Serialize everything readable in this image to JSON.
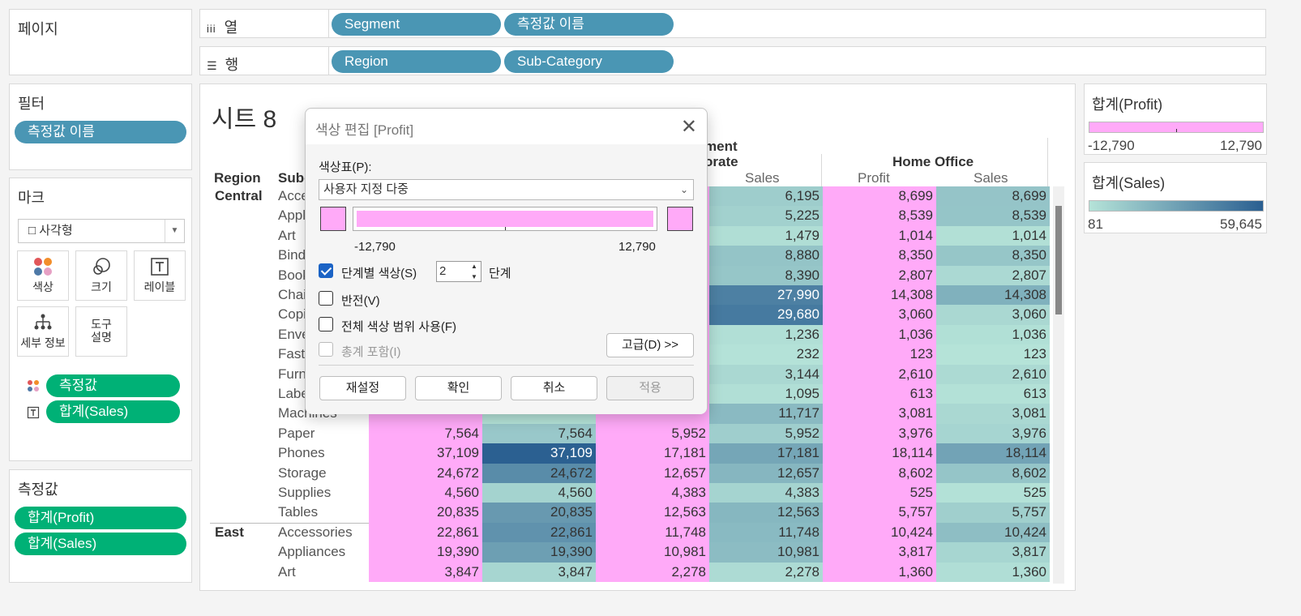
{
  "pages_panel": {
    "title": "페이지"
  },
  "filters_panel": {
    "title": "필터",
    "items": [
      "측정값 이름"
    ]
  },
  "marks_panel": {
    "title": "마크",
    "mark_type": "□ 사각형",
    "buttons": {
      "color": "색상",
      "size": "크기",
      "label": "레이블",
      "detail": "세부 정보",
      "tooltip_1": "도구",
      "tooltip_2": "설명"
    },
    "fields": [
      "측정값",
      "합계(Sales)"
    ]
  },
  "measure_values_panel": {
    "title": "측정값",
    "items": [
      "합계(Profit)",
      "합계(Sales)"
    ]
  },
  "columns_shelf": {
    "label": "열",
    "pills": [
      "Segment",
      "측정값 이름"
    ]
  },
  "rows_shelf": {
    "label": "행",
    "pills": [
      "Region",
      "Sub-Category"
    ]
  },
  "sheet": {
    "title": "시트 8",
    "segment_header_part1": "ment",
    "corporate_header_part": "orate",
    "home_office_header": "Home Office",
    "region_header": "Region",
    "subcat_header": "Sub-",
    "measure_headers": [
      "Sales",
      "Profit",
      "Sales"
    ],
    "rows": [
      {
        "region": "Central",
        "sub": "Acce",
        "v": [
          "",
          "",
          "",
          "6,195",
          "8,699",
          "8,699"
        ]
      },
      {
        "region": "",
        "sub": "Appl",
        "v": [
          "",
          "",
          "",
          "5,225",
          "8,539",
          "8,539"
        ]
      },
      {
        "region": "",
        "sub": "Art",
        "v": [
          "",
          "",
          "",
          "1,479",
          "1,014",
          "1,014"
        ]
      },
      {
        "region": "",
        "sub": "Bind",
        "v": [
          "",
          "",
          "",
          "8,880",
          "8,350",
          "8,350"
        ]
      },
      {
        "region": "",
        "sub": "Book",
        "v": [
          "",
          "",
          "",
          "8,390",
          "2,807",
          "2,807"
        ]
      },
      {
        "region": "",
        "sub": "Chai",
        "v": [
          "",
          "",
          "",
          "27,990",
          "14,308",
          "14,308"
        ]
      },
      {
        "region": "",
        "sub": "Copi",
        "v": [
          "",
          "",
          "",
          "29,680",
          "3,060",
          "3,060"
        ]
      },
      {
        "region": "",
        "sub": "Enve",
        "v": [
          "",
          "",
          "",
          "1,236",
          "1,036",
          "1,036"
        ]
      },
      {
        "region": "",
        "sub": "Fast",
        "v": [
          "",
          "",
          "",
          "232",
          "123",
          "123"
        ]
      },
      {
        "region": "",
        "sub": "Furn",
        "v": [
          "",
          "",
          "",
          "3,144",
          "2,610",
          "2,610"
        ]
      },
      {
        "region": "",
        "sub": "Labe",
        "v": [
          "",
          "",
          "",
          "1,095",
          "613",
          "613"
        ]
      },
      {
        "region": "",
        "sub": "Machines",
        "v": [
          "",
          "",
          "",
          "11,717",
          "3,081",
          "3,081"
        ]
      },
      {
        "region": "",
        "sub": "Paper",
        "v": [
          "7,564",
          "7,564",
          "5,952",
          "5,952",
          "3,976",
          "3,976"
        ]
      },
      {
        "region": "",
        "sub": "Phones",
        "v": [
          "37,109",
          "37,109",
          "17,181",
          "17,181",
          "18,114",
          "18,114"
        ]
      },
      {
        "region": "",
        "sub": "Storage",
        "v": [
          "24,672",
          "24,672",
          "12,657",
          "12,657",
          "8,602",
          "8,602"
        ]
      },
      {
        "region": "",
        "sub": "Supplies",
        "v": [
          "4,560",
          "4,560",
          "4,383",
          "4,383",
          "525",
          "525"
        ]
      },
      {
        "region": "",
        "sub": "Tables",
        "v": [
          "20,835",
          "20,835",
          "12,563",
          "12,563",
          "5,757",
          "5,757"
        ]
      },
      {
        "region": "East",
        "sub": "Accessories",
        "v": [
          "22,861",
          "22,861",
          "11,748",
          "11,748",
          "10,424",
          "10,424"
        ]
      },
      {
        "region": "",
        "sub": "Appliances",
        "v": [
          "19,390",
          "19,390",
          "10,981",
          "10,981",
          "3,817",
          "3,817"
        ]
      },
      {
        "region": "",
        "sub": "Art",
        "v": [
          "3,847",
          "3,847",
          "2,278",
          "2,278",
          "1,360",
          "1,360"
        ]
      }
    ]
  },
  "legend_profit": {
    "title": "합계(Profit)",
    "min": "-12,790",
    "max": "12,790",
    "color": "#ffaaf8"
  },
  "legend_sales": {
    "title": "합계(Sales)",
    "min": "81",
    "max": "59,645",
    "color_low": "#b5e3d8",
    "color_high": "#2a5f91"
  },
  "dialog": {
    "title": "색상 편집 [Profit]",
    "palette_label": "색상표(P):",
    "palette_value": "사용자 지정 다중",
    "range_min": "-12,790",
    "range_max": "12,790",
    "stepped_label": "단계별 색상(S)",
    "steps_value": "2",
    "steps_unit": "단계",
    "reversed_label": "반전(V)",
    "full_range_label": "전체 색상 범위 사용(F)",
    "include_totals_label": "총계 포함(I)",
    "advanced_button": "고급(D) >>",
    "reset_button": "재설정",
    "ok_button": "확인",
    "cancel_button": "취소",
    "apply_button": "적용",
    "swatch_color": "#ffaaf8"
  }
}
